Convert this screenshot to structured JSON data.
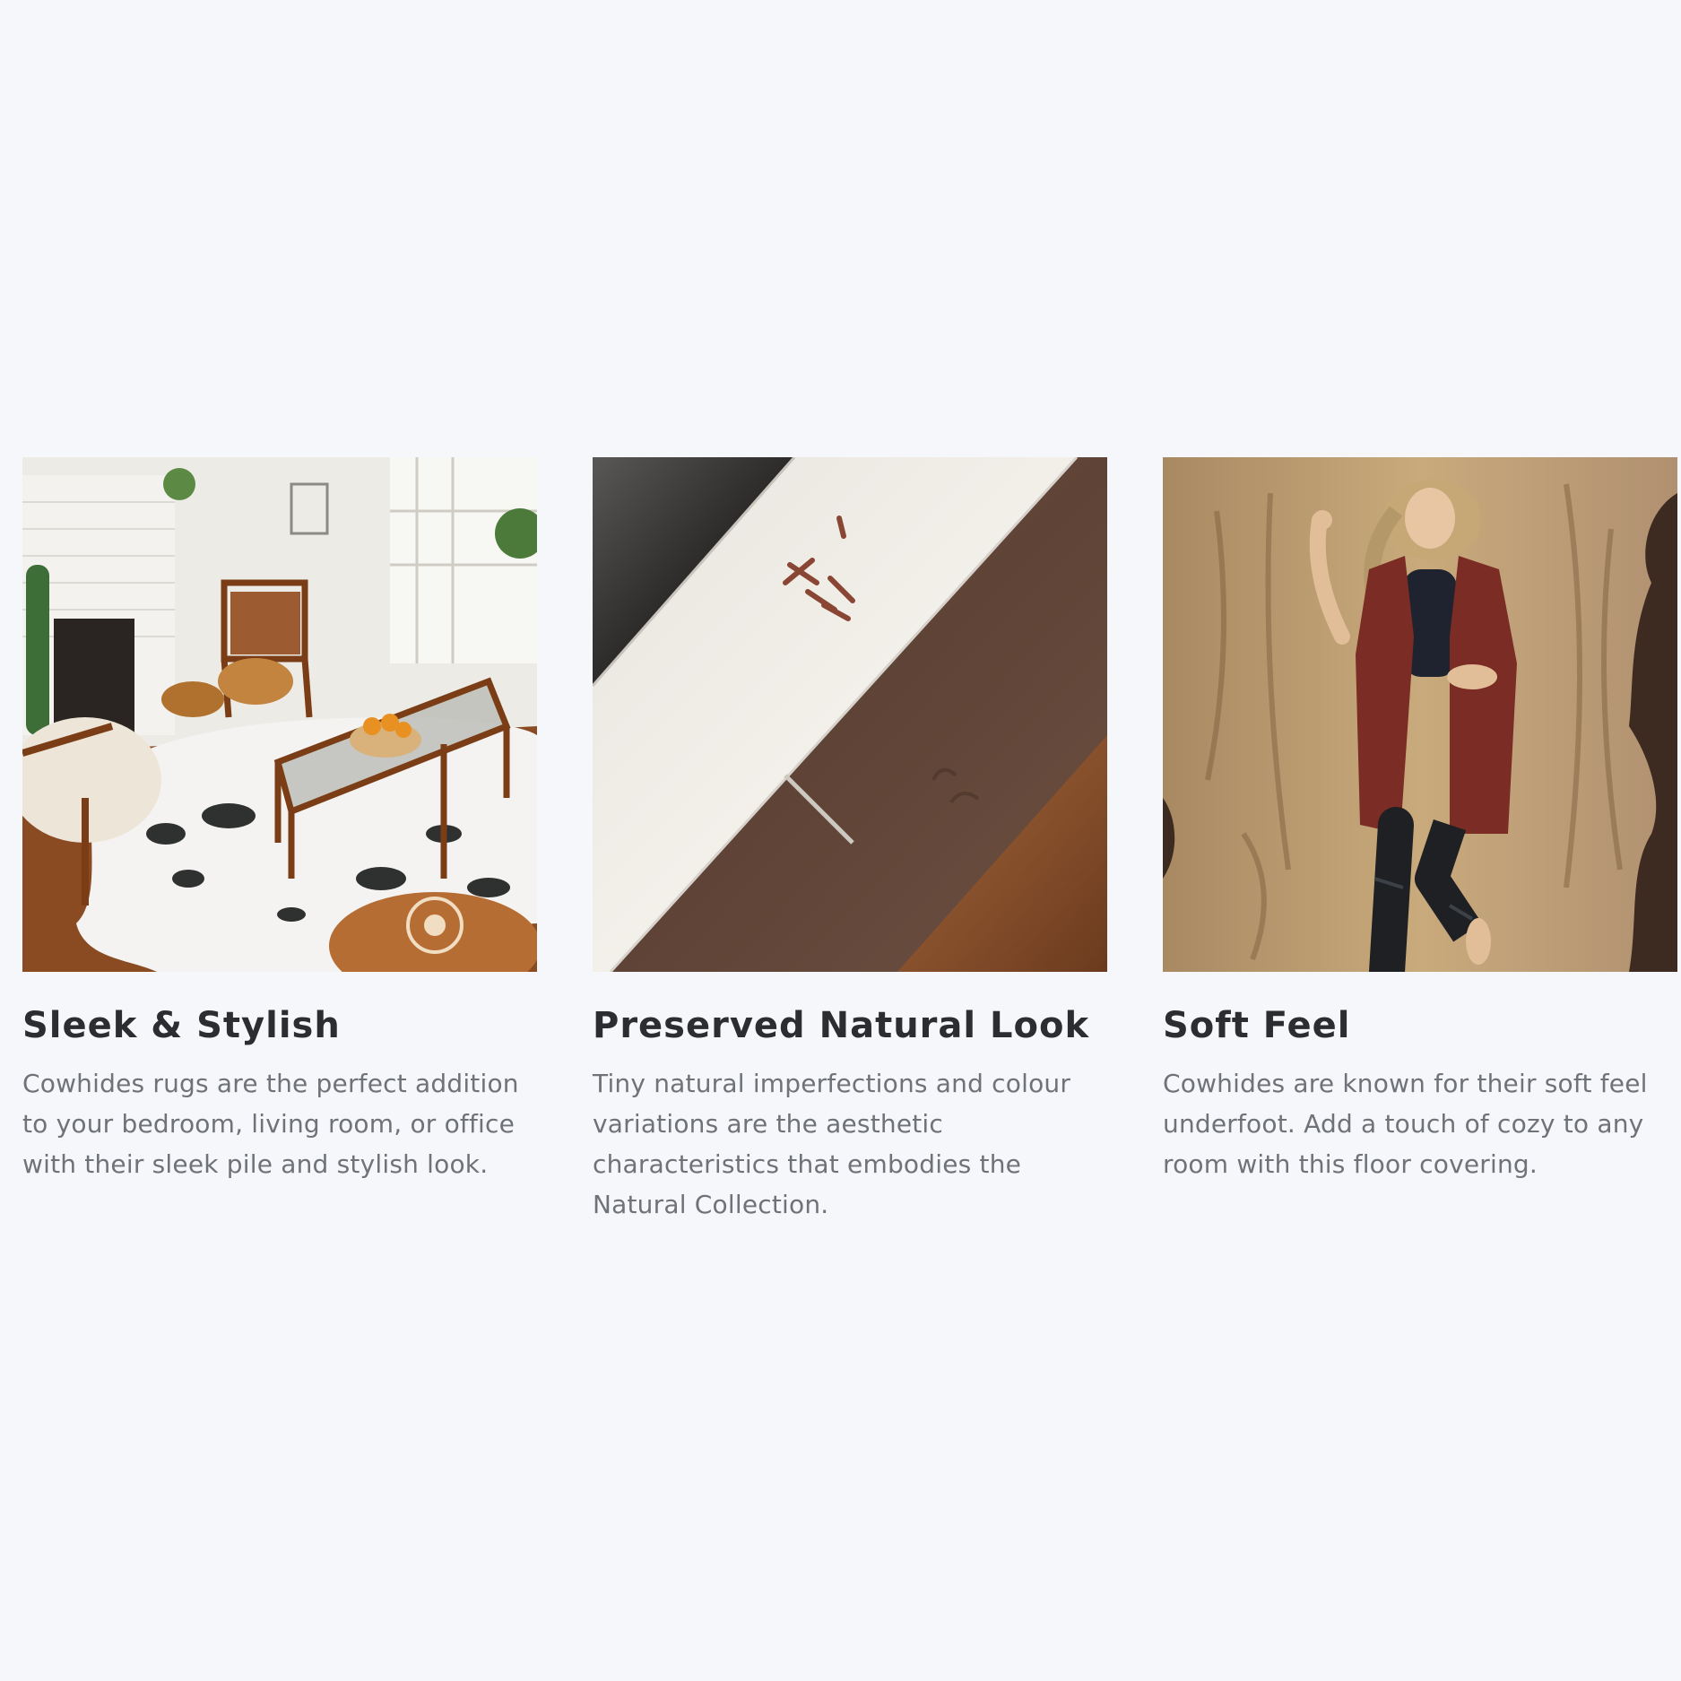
{
  "features": [
    {
      "image": "living-room-with-white-spotted-cowhide-rug",
      "title": "Sleek & Stylish",
      "description": "Cowhides rugs are the perfect addition to your bedroom, living room, or office with their sleek pile and stylish look."
    },
    {
      "image": "diagonal-cowhide-texture-swatches",
      "title": "Preserved Natural Look",
      "description": "Tiny natural imperfections and colour variations are the aesthetic characteristics that embodies the Natural Collection."
    },
    {
      "image": "woman-lying-on-brindle-cowhide-rug",
      "title": "Soft Feel",
      "description": "Cowhides are known for their soft feel underfoot. Add a touch of cozy to any room with this floor covering."
    }
  ],
  "colors": {
    "background": "#f6f7fa",
    "title": "#2b2d31",
    "description": "#6f7278"
  }
}
